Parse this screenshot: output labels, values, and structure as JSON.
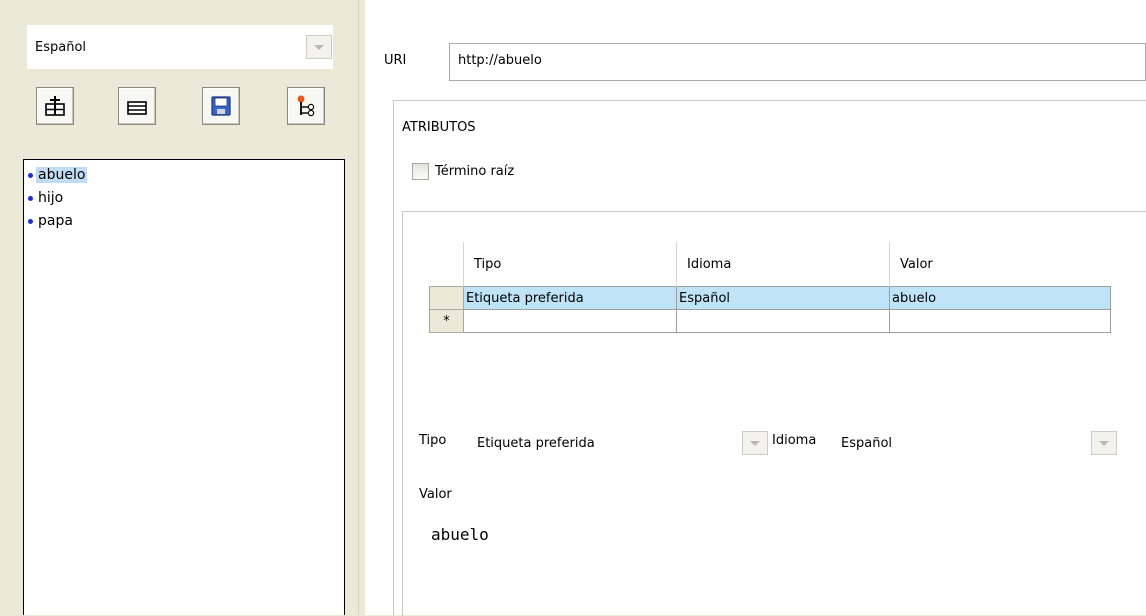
{
  "left": {
    "language_select": {
      "value": "Español"
    },
    "toolbar": [
      {
        "name": "add-term-button",
        "icon": "add-term-icon"
      },
      {
        "name": "remove-term-button",
        "icon": "remove-term-icon"
      },
      {
        "name": "save-button",
        "icon": "floppy-disk-icon"
      },
      {
        "name": "hierarchy-button",
        "icon": "hierarchy-icon"
      }
    ],
    "tree": {
      "items": [
        {
          "label": "abuelo",
          "selected": true
        },
        {
          "label": "hijo",
          "selected": false
        },
        {
          "label": "papa",
          "selected": false
        }
      ]
    }
  },
  "right": {
    "uri": {
      "label": "URI",
      "value": "http://abuelo"
    },
    "attributes": {
      "title": "ATRIBUTOS",
      "root_term": {
        "label": "Término raíz",
        "checked": false
      },
      "table": {
        "headers": [
          "Tipo",
          "Idioma",
          "Valor"
        ],
        "rows": [
          {
            "marker": "",
            "cells": [
              "Etiqueta preferida",
              "Español",
              "abuelo"
            ],
            "selected": true
          },
          {
            "marker": "*",
            "cells": [
              "",
              "",
              ""
            ],
            "selected": false
          }
        ]
      },
      "editor": {
        "tipo_label": "Tipo",
        "tipo_value": "Etiqueta preferida",
        "idioma_label": "Idioma",
        "idioma_value": "Español",
        "valor_label": "Valor",
        "valor_value": "abuelo"
      }
    }
  },
  "colors": {
    "selection": "#c1ddf5",
    "row_selection": "#bfe4f7",
    "panel": "#ece9d8",
    "tree_bullet": "#1e2fd0"
  }
}
